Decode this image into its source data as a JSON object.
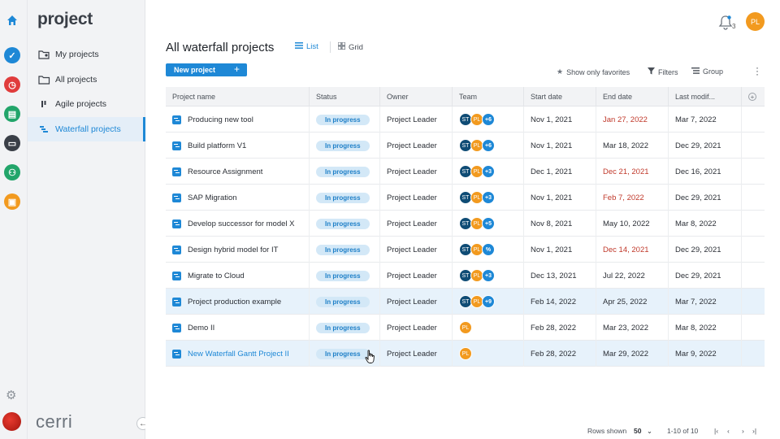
{
  "app": {
    "brand": "project",
    "company": "cerri"
  },
  "rail": {
    "buttons": [
      {
        "name": "home",
        "color": "#1e88d6"
      },
      {
        "name": "tasks",
        "color": "#1e88d6"
      },
      {
        "name": "time",
        "color": "#e03c3c"
      },
      {
        "name": "documents",
        "color": "#22a56a"
      },
      {
        "name": "projects",
        "color": "#3a3f47"
      },
      {
        "name": "team",
        "color": "#22a56a"
      },
      {
        "name": "portfolio",
        "color": "#f29a1f"
      }
    ]
  },
  "sidebar": {
    "items": [
      {
        "label": "My projects",
        "icon": "user-folder-icon"
      },
      {
        "label": "All projects",
        "icon": "folder-icon"
      },
      {
        "label": "Agile projects",
        "icon": "board-icon"
      },
      {
        "label": "Waterfall projects",
        "icon": "waterfall-icon"
      }
    ]
  },
  "header": {
    "notification_count": "3",
    "user_initials": "PL"
  },
  "page": {
    "title": "All waterfall projects",
    "view_list": "List",
    "view_grid": "Grid",
    "new_project": "New project",
    "favorites": "Show only favorites",
    "filters": "Filters",
    "group": "Group"
  },
  "table": {
    "columns": [
      "Project name",
      "Status",
      "Owner",
      "Team",
      "Start date",
      "End date",
      "Last modif..."
    ],
    "rows": [
      {
        "name": "Producing new tool",
        "status": "In progress",
        "owner": "Project Leader",
        "team": [
          "ST",
          "PL",
          "+6"
        ],
        "start": "Nov 1, 2021",
        "end": "Jan 27, 2022",
        "end_overdue": true,
        "modified": "Mar 7, 2022"
      },
      {
        "name": "Build platform V1",
        "status": "In progress",
        "owner": "Project Leader",
        "team": [
          "ST",
          "PL",
          "+6"
        ],
        "start": "Nov 1, 2021",
        "end": "Mar 18, 2022",
        "end_overdue": false,
        "modified": "Dec 29, 2021"
      },
      {
        "name": "Resource Assignment",
        "status": "In progress",
        "owner": "Project Leader",
        "team": [
          "ST",
          "PL",
          "+3"
        ],
        "start": "Dec 1, 2021",
        "end": "Dec 21, 2021",
        "end_overdue": true,
        "modified": "Dec 16, 2021"
      },
      {
        "name": "SAP Migration",
        "status": "In progress",
        "owner": "Project Leader",
        "team": [
          "ST",
          "PL",
          "+3"
        ],
        "start": "Nov 1, 2021",
        "end": "Feb 7, 2022",
        "end_overdue": true,
        "modified": "Dec 29, 2021"
      },
      {
        "name": "Develop successor for model X",
        "status": "In progress",
        "owner": "Project Leader",
        "team": [
          "ST",
          "PL",
          "+5"
        ],
        "start": "Nov 8, 2021",
        "end": "May 10, 2022",
        "end_overdue": false,
        "modified": "Mar 8, 2022"
      },
      {
        "name": "Design hybrid model for IT",
        "status": "In progress",
        "owner": "Project Leader",
        "team": [
          "ST",
          "PL",
          "%"
        ],
        "start": "Nov 1, 2021",
        "end": "Dec 14, 2021",
        "end_overdue": true,
        "modified": "Dec 29, 2021"
      },
      {
        "name": "Migrate to Cloud",
        "status": "In progress",
        "owner": "Project Leader",
        "team": [
          "ST",
          "PL",
          "+3"
        ],
        "start": "Dec 13, 2021",
        "end": "Jul 22, 2022",
        "end_overdue": false,
        "modified": "Dec 29, 2021"
      },
      {
        "name": "Project production example",
        "status": "In progress",
        "owner": "Project Leader",
        "team": [
          "ST",
          "PL",
          "+9"
        ],
        "start": "Feb 14, 2022",
        "end": "Apr 25, 2022",
        "end_overdue": false,
        "modified": "Mar 7, 2022"
      },
      {
        "name": "Demo II",
        "status": "In progress",
        "owner": "Project Leader",
        "team": [
          "PL"
        ],
        "start": "Feb 28, 2022",
        "end": "Mar 23, 2022",
        "end_overdue": false,
        "modified": "Mar 8, 2022"
      },
      {
        "name": "New Waterfall Gantt Project II",
        "status": "In progress",
        "owner": "Project Leader",
        "team": [
          "PL"
        ],
        "start": "Feb 28, 2022",
        "end": "Mar 29, 2022",
        "end_overdue": false,
        "modified": "Mar 9, 2022"
      }
    ],
    "highlighted_rows": [
      7,
      9
    ],
    "link_row": 9
  },
  "pagination": {
    "rows_shown_label": "Rows shown",
    "rows_shown_value": "50",
    "range": "1-10 of 10"
  },
  "colors": {
    "accent": "#1e88d6",
    "overdue": "#c0392b",
    "avatar_pl": "#f29a1f",
    "avatar_st": "#0f4c75"
  }
}
